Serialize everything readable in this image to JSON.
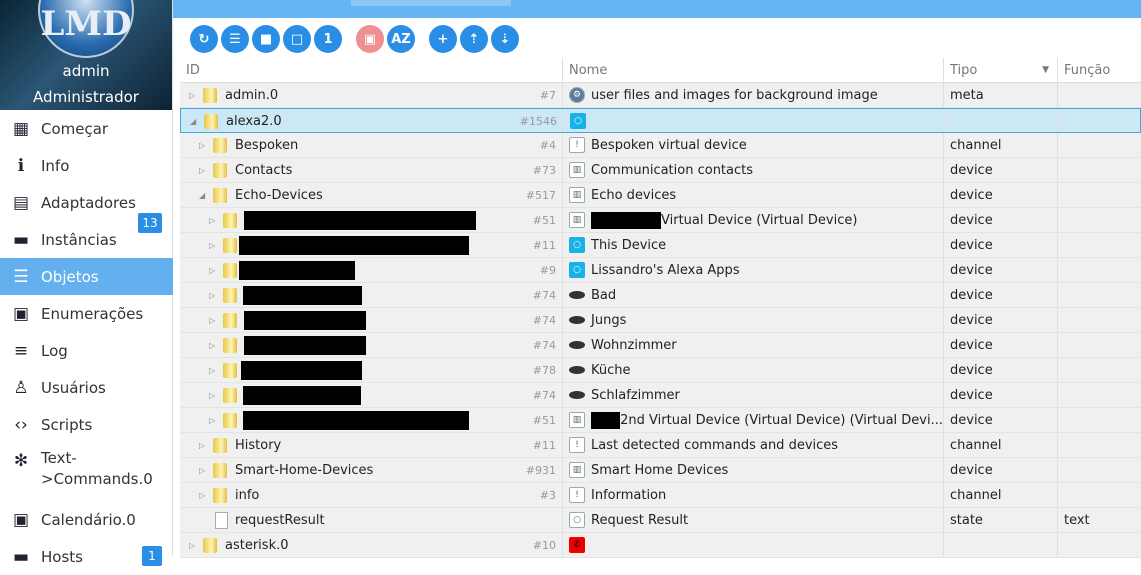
{
  "user": {
    "logo_text": "LMD",
    "name": "admin",
    "role": "Administrador"
  },
  "nav": [
    {
      "label": "Começar",
      "icon": "grid-icon",
      "glyph": "▦"
    },
    {
      "label": "Info",
      "icon": "info-icon",
      "glyph": "ℹ"
    },
    {
      "label": "Adaptadores",
      "icon": "store-icon",
      "glyph": "▤",
      "badge": "13"
    },
    {
      "label": "Instâncias",
      "icon": "instances-icon",
      "glyph": "▬"
    },
    {
      "label": "Objetos",
      "icon": "list-icon",
      "glyph": "☰",
      "active": true
    },
    {
      "label": "Enumerações",
      "icon": "card-icon",
      "glyph": "▣"
    },
    {
      "label": "Log",
      "icon": "log-icon",
      "glyph": "≡"
    },
    {
      "label": "Usuários",
      "icon": "user-icon",
      "glyph": "♙"
    },
    {
      "label": "Scripts",
      "icon": "code-icon",
      "glyph": "‹›"
    },
    {
      "label": "Text->Commands.0",
      "icon": "snowflake-icon",
      "glyph": "✻"
    },
    {
      "label": "Calendário.0",
      "icon": "calendar-icon",
      "glyph": "▣"
    },
    {
      "label": "Hosts",
      "icon": "hosts-icon",
      "glyph": "▬",
      "badge": "1"
    }
  ],
  "toolbar": [
    {
      "name": "refresh",
      "glyph": "↻"
    },
    {
      "name": "list",
      "glyph": "☰"
    },
    {
      "name": "folder-filled",
      "glyph": "■"
    },
    {
      "name": "folder-outline",
      "glyph": "□"
    },
    {
      "name": "one",
      "glyph": "1"
    },
    {
      "name": "contact",
      "glyph": "▣",
      "color": "#ef8f8f"
    },
    {
      "name": "sort-az",
      "glyph": "AZ"
    },
    {
      "name": "add",
      "glyph": "+"
    },
    {
      "name": "upload",
      "glyph": "⇡"
    },
    {
      "name": "download",
      "glyph": "⇣"
    }
  ],
  "columns": {
    "id": "ID",
    "name": "Nome",
    "type": "Tipo",
    "role": "Função",
    "sort_glyph": "▼"
  },
  "rows": [
    {
      "level": 0,
      "kind": "folder",
      "id": "admin.0",
      "num": "#7",
      "icon": "gear",
      "name": "user files and images for background image",
      "type": "meta",
      "role": ""
    },
    {
      "level": 0,
      "kind": "folder",
      "expanded": true,
      "selected": true,
      "id": "alexa2.0",
      "num": "#1546",
      "icon": "alexa",
      "name": "",
      "type": "",
      "role": ""
    },
    {
      "level": 1,
      "kind": "folder",
      "id": "Bespoken",
      "num": "#4",
      "icon": "channel",
      "name": "Bespoken virtual device",
      "type": "channel",
      "role": ""
    },
    {
      "level": 1,
      "kind": "folder",
      "id": "Contacts",
      "num": "#73",
      "icon": "device",
      "name": "Communication contacts",
      "type": "device",
      "role": ""
    },
    {
      "level": 1,
      "kind": "folder",
      "expanded": true,
      "id": "Echo-Devices",
      "num": "#517",
      "icon": "device",
      "name": "Echo devices",
      "type": "device",
      "role": ""
    },
    {
      "level": 2,
      "kind": "folder",
      "redact": [
        64,
        232
      ],
      "num": "#51",
      "icon": "device",
      "name_redact": true,
      "name": "Virtual Device (Virtual Device)",
      "type": "device",
      "role": ""
    },
    {
      "level": 2,
      "kind": "folder",
      "redact": [
        59,
        230
      ],
      "num": "#11",
      "icon": "alexa",
      "name": "This Device",
      "type": "device",
      "role": ""
    },
    {
      "level": 2,
      "kind": "folder",
      "redact": [
        59,
        116
      ],
      "num": "#9",
      "icon": "alexa",
      "name": "Lissandro's Alexa Apps",
      "type": "device",
      "role": ""
    },
    {
      "level": 2,
      "kind": "folder",
      "redact": [
        63,
        119
      ],
      "num": "#74",
      "icon": "echo",
      "name": "Bad",
      "type": "device",
      "role": ""
    },
    {
      "level": 2,
      "kind": "folder",
      "redact": [
        64,
        122
      ],
      "num": "#74",
      "icon": "echo",
      "name": "Jungs",
      "type": "device",
      "role": ""
    },
    {
      "level": 2,
      "kind": "folder",
      "redact": [
        64,
        122
      ],
      "num": "#74",
      "icon": "echo",
      "name": "Wohnzimmer",
      "type": "device",
      "role": ""
    },
    {
      "level": 2,
      "kind": "folder",
      "redact": [
        61,
        121
      ],
      "num": "#78",
      "icon": "echo",
      "name": "Küche",
      "type": "device",
      "role": ""
    },
    {
      "level": 2,
      "kind": "folder",
      "redact": [
        63,
        118
      ],
      "num": "#74",
      "icon": "echo",
      "name": "Schlafzimmer",
      "type": "device",
      "role": ""
    },
    {
      "level": 2,
      "kind": "folder",
      "redact": [
        63,
        226
      ],
      "num": "#51",
      "icon": "device",
      "name_redact": true,
      "name": "2nd Virtual Device (Virtual Device) (Virtual Devi...",
      "type": "device",
      "role": ""
    },
    {
      "level": 1,
      "kind": "folder",
      "id": "History",
      "num": "#11",
      "icon": "channel",
      "name": "Last detected commands and devices",
      "type": "channel",
      "role": ""
    },
    {
      "level": 1,
      "kind": "folder",
      "id": "Smart-Home-Devices",
      "num": "#931",
      "icon": "device",
      "name": "Smart Home Devices",
      "type": "device",
      "role": ""
    },
    {
      "level": 1,
      "kind": "folder",
      "id": "info",
      "num": "#3",
      "icon": "channel",
      "name": "Information",
      "type": "channel",
      "role": ""
    },
    {
      "level": 1,
      "kind": "file",
      "id": "requestResult",
      "num": "",
      "icon": "state",
      "name": "Request Result",
      "type": "state",
      "role": "text"
    },
    {
      "level": 0,
      "kind": "folder",
      "id": "asterisk.0",
      "num": "#10",
      "icon": "phone",
      "name": "",
      "type": "",
      "role": ""
    }
  ]
}
